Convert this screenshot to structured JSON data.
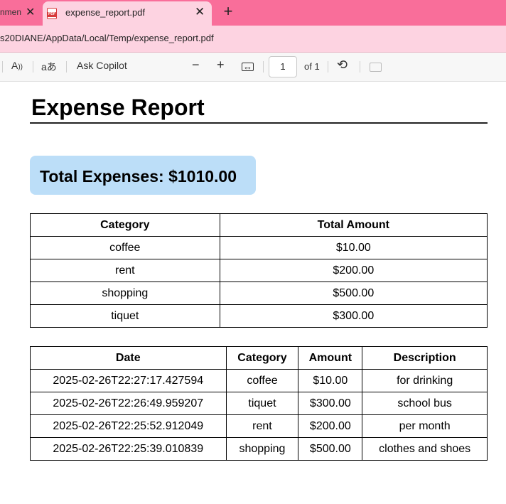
{
  "browser": {
    "prev_tab_title": "nmen",
    "active_tab_title": "expense_report.pdf",
    "url": "s20DIANE/AppData/Local/Temp/expense_report.pdf"
  },
  "toolbar": {
    "ask_copilot": "Ask Copilot",
    "page_number": "1",
    "page_total": "of 1"
  },
  "document": {
    "title": "Expense Report",
    "total_label": "Total Expenses: $1010.00",
    "summary_table": {
      "headers": [
        "Category",
        "Total Amount"
      ],
      "rows": [
        [
          "coffee",
          "$10.00"
        ],
        [
          "rent",
          "$200.00"
        ],
        [
          "shopping",
          "$500.00"
        ],
        [
          "tiquet",
          "$300.00"
        ]
      ]
    },
    "detail_table": {
      "headers": [
        "Date",
        "Category",
        "Amount",
        "Description"
      ],
      "rows": [
        [
          "2025-02-26T22:27:17.427594",
          "coffee",
          "$10.00",
          "for drinking"
        ],
        [
          "2025-02-26T22:26:49.959207",
          "tiquet",
          "$300.00",
          "school bus"
        ],
        [
          "2025-02-26T22:25:52.912049",
          "rent",
          "$200.00",
          "per month"
        ],
        [
          "2025-02-26T22:25:39.010839",
          "shopping",
          "$500.00",
          "clothes and shoes"
        ]
      ]
    }
  },
  "colors": {
    "tab_strip": "#f96e9a",
    "active_tab": "#fdd3e1",
    "total_box": "#bcdef8"
  }
}
